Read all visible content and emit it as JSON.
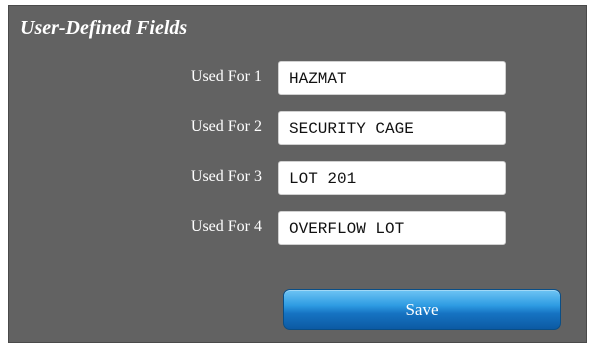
{
  "panel": {
    "title": "User-Defined Fields"
  },
  "fields": [
    {
      "label": "Used For 1",
      "value": "HAZMAT"
    },
    {
      "label": "Used For 2",
      "value": "SECURITY CAGE"
    },
    {
      "label": "Used For 3",
      "value": "LOT 201"
    },
    {
      "label": "Used For 4",
      "value": "OVERFLOW LOT"
    }
  ],
  "actions": {
    "save_label": "Save"
  },
  "colors": {
    "panel_background": "#626262",
    "button_blue": "#1673c2",
    "text_white": "#ffffff"
  }
}
